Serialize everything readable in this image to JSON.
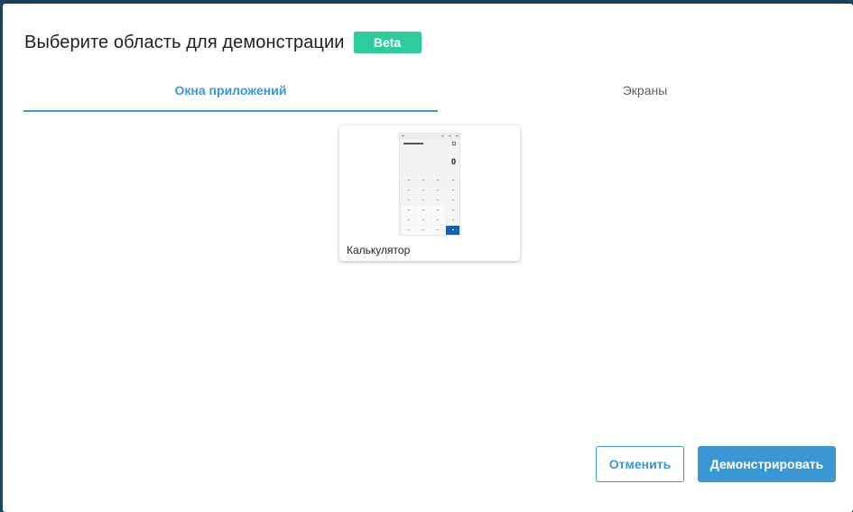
{
  "dialog": {
    "title": "Выберите область для демонстрации",
    "badge": "Beta"
  },
  "tabs": [
    {
      "label": "Окна приложений",
      "active": true
    },
    {
      "label": "Экраны",
      "active": false
    }
  ],
  "windows": [
    {
      "label": "Калькулятор",
      "thumbnail_display_value": "0"
    }
  ],
  "actions": {
    "cancel_label": "Отменить",
    "share_label": "Демонстрировать"
  },
  "colors": {
    "accent": "#3a97d4",
    "badge": "#2ecc9a",
    "backdrop": "#1f4a66"
  }
}
